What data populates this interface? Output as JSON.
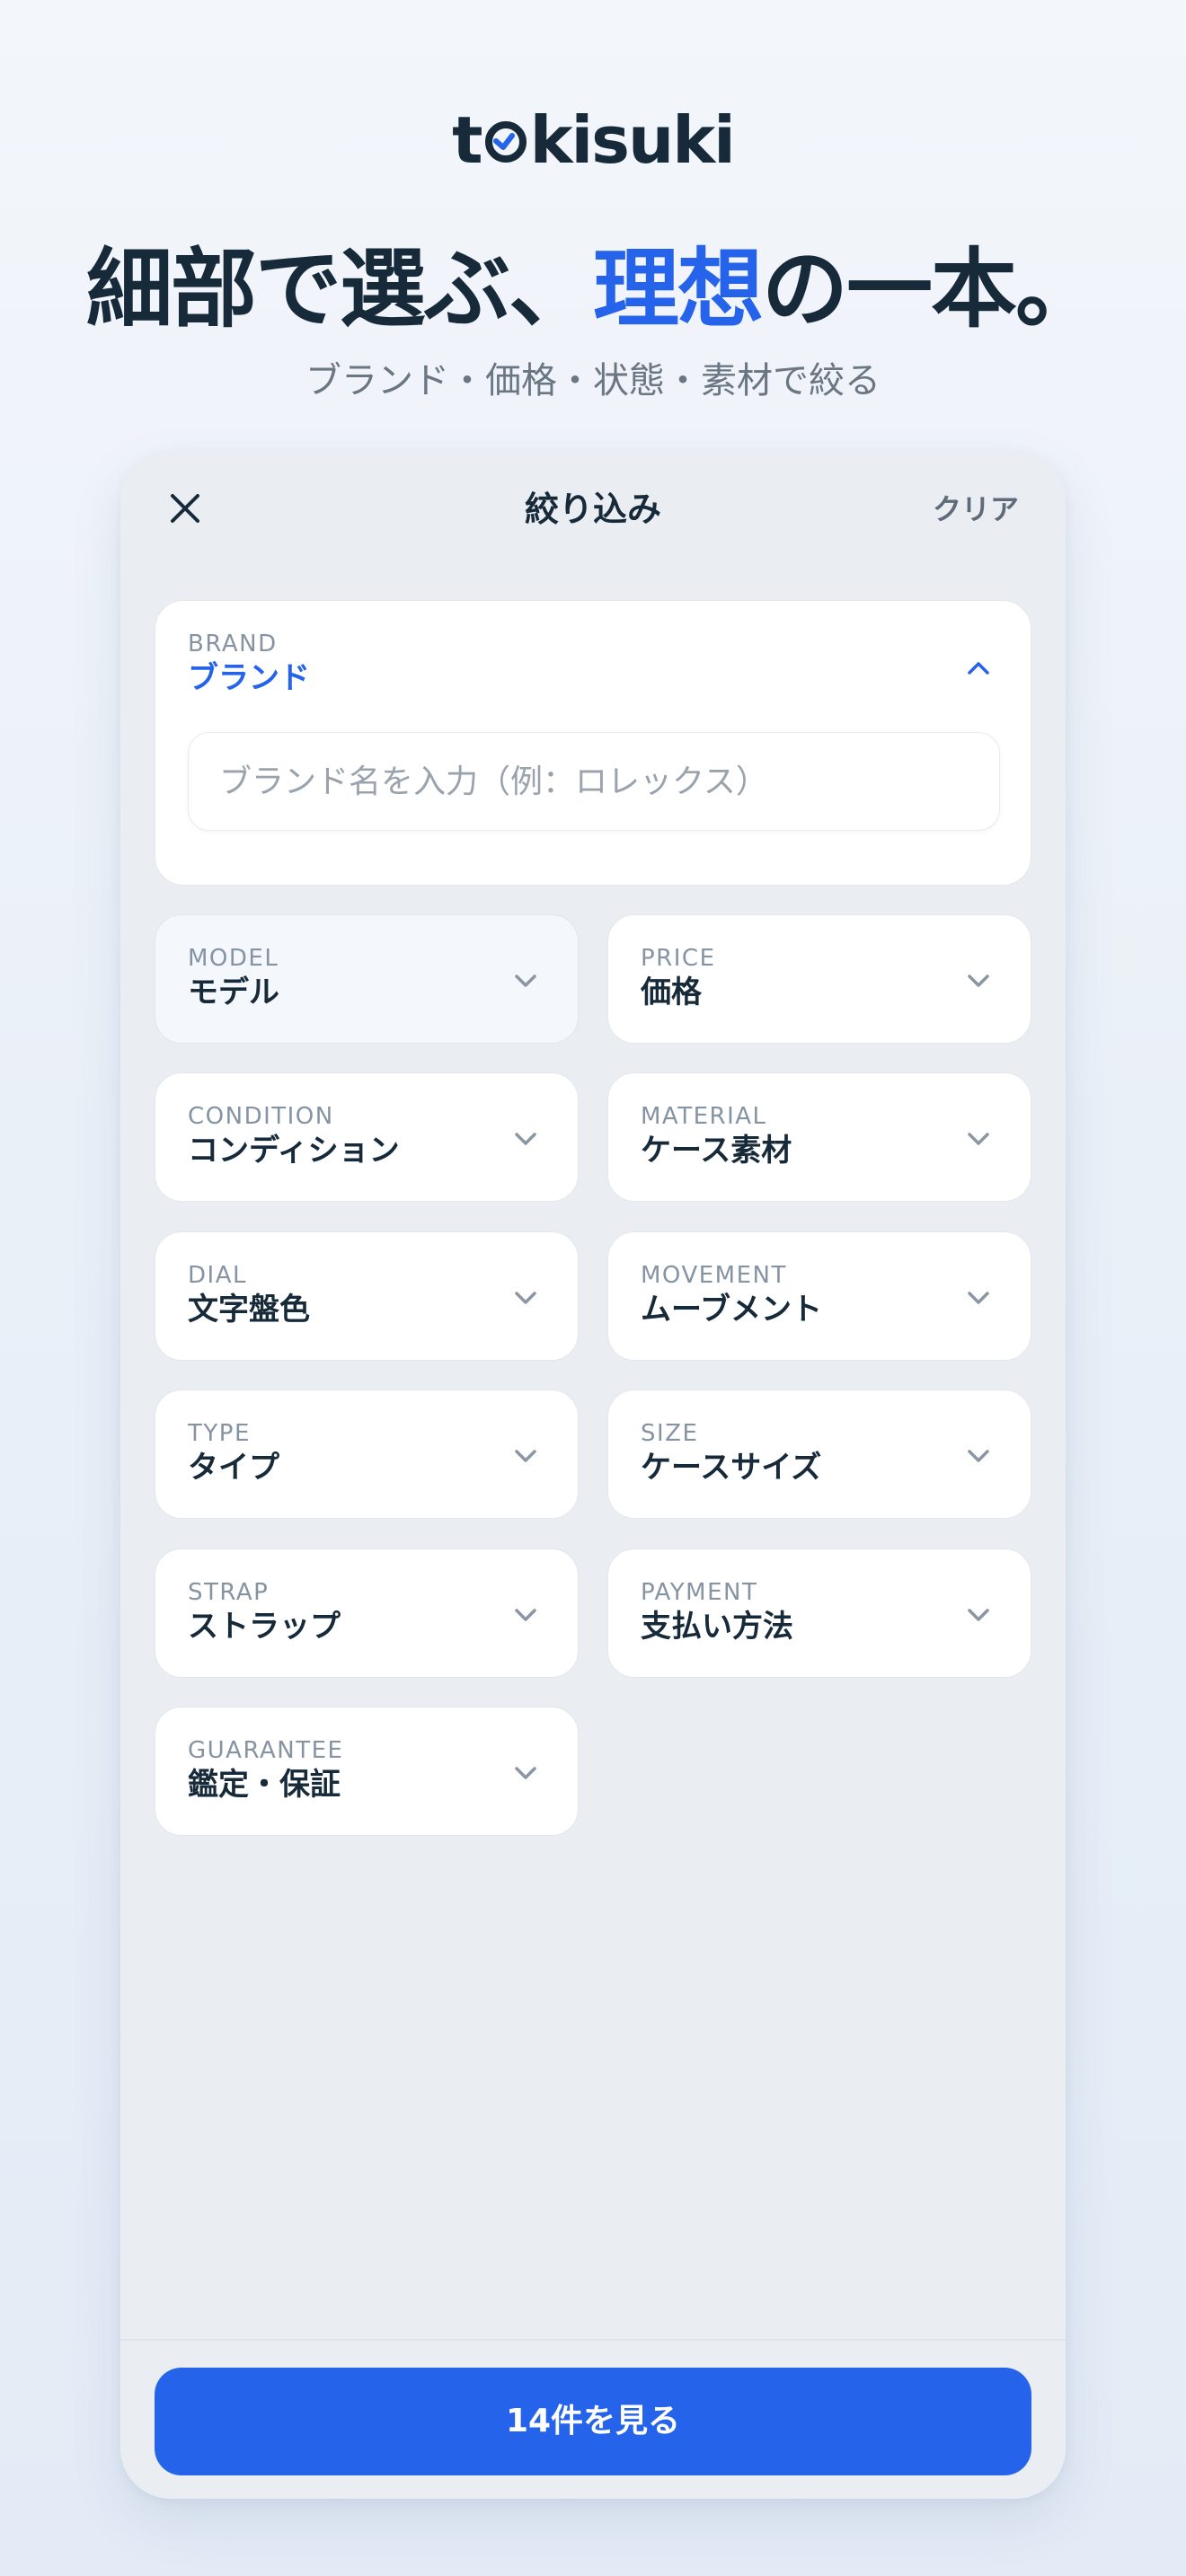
{
  "brand": {
    "logo_before": "t",
    "logo_after": "kisuki",
    "logo_icon": "clock-o-icon"
  },
  "hero": {
    "headline_part1": "細部で選ぶ、",
    "headline_accent": "理想",
    "headline_part2": "の一本。",
    "subtitle": "ブランド・価格・状態・素材で絞る"
  },
  "panel": {
    "title": "絞り込み",
    "close_icon": "close-icon",
    "clear_label": "クリア"
  },
  "brand_filter": {
    "label_en": "BRAND",
    "label_ja": "ブランド",
    "expanded": true,
    "input_value": "",
    "input_placeholder": "ブランド名を入力（例：ロレックス）"
  },
  "filters": [
    {
      "label_en": "MODEL",
      "label_ja": "モデル"
    },
    {
      "label_en": "PRICE",
      "label_ja": "価格"
    },
    {
      "label_en": "CONDITION",
      "label_ja": "コンディション"
    },
    {
      "label_en": "MATERIAL",
      "label_ja": "ケース素材"
    },
    {
      "label_en": "DIAL",
      "label_ja": "文字盤色"
    },
    {
      "label_en": "MOVEMENT",
      "label_ja": "ムーブメント"
    },
    {
      "label_en": "TYPE",
      "label_ja": "タイプ"
    },
    {
      "label_en": "SIZE",
      "label_ja": "ケースサイズ"
    },
    {
      "label_en": "STRAP",
      "label_ja": "ストラップ"
    },
    {
      "label_en": "PAYMENT",
      "label_ja": "支払い方法"
    },
    {
      "label_en": "GUARANTEE",
      "label_ja": "鑑定・保証"
    }
  ],
  "footer": {
    "cta_label": "14件を見る"
  },
  "colors": {
    "accent": "#2563eb",
    "text_primary": "#172a3a",
    "text_muted": "#8593a3"
  }
}
